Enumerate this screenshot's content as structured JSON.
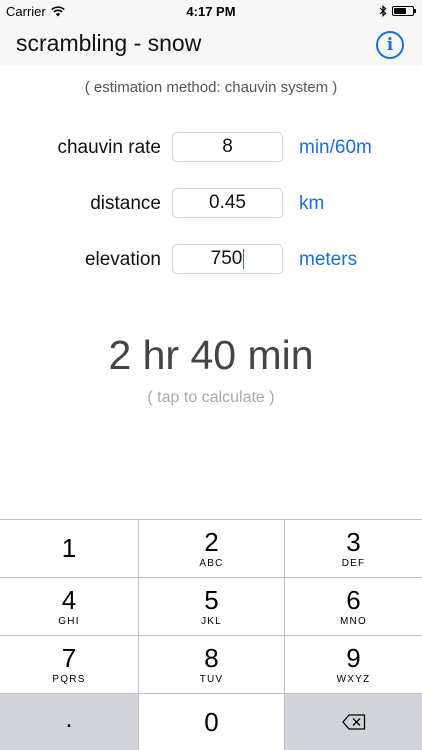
{
  "status_bar": {
    "carrier": "Carrier",
    "time": "4:17 PM"
  },
  "nav": {
    "title": "scrambling - snow",
    "info_icon": "info-circle-icon",
    "accent_color": "#1a6fd6"
  },
  "method_text": "( estimation method: chauvin system )",
  "fields": [
    {
      "label": "chauvin rate",
      "value": "8",
      "unit": "min/60m"
    },
    {
      "label": "distance",
      "value": "0.45",
      "unit": "km"
    },
    {
      "label": "elevation",
      "value": "750",
      "unit": "meters"
    }
  ],
  "result": {
    "value": "2 hr 40 min",
    "hint": "( tap to calculate )"
  },
  "keypad": {
    "keys": [
      {
        "digit": "1",
        "letters": ""
      },
      {
        "digit": "2",
        "letters": "ABC"
      },
      {
        "digit": "3",
        "letters": "DEF"
      },
      {
        "digit": "4",
        "letters": "GHI"
      },
      {
        "digit": "5",
        "letters": "JKL"
      },
      {
        "digit": "6",
        "letters": "MNO"
      },
      {
        "digit": "7",
        "letters": "PQRS"
      },
      {
        "digit": "8",
        "letters": "TUV"
      },
      {
        "digit": "9",
        "letters": "WXYZ"
      }
    ],
    "dot": ".",
    "zero": "0",
    "delete_icon": "backspace-icon"
  }
}
